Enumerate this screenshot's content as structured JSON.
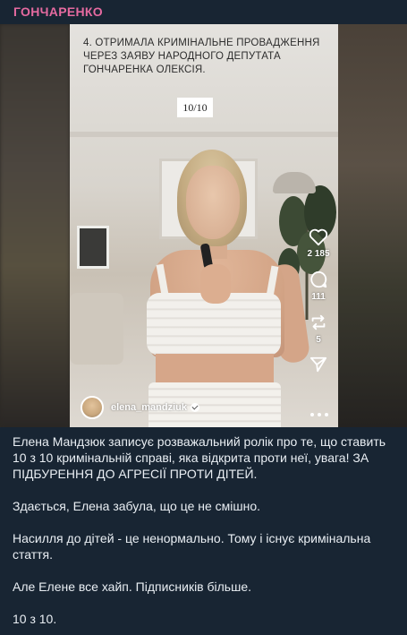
{
  "channel": {
    "name": "ГОНЧАРЕНКО"
  },
  "video": {
    "caption": "4. ОТРИМАЛА КРИМІНАЛЬНЕ ПРОВАДЖЕННЯ ЧЕРЕЗ ЗАЯВУ НАРОДНОГО ДЕПУТАТА ГОНЧАРЕНКА ОЛЕКСІЯ.",
    "counter": "10/10",
    "likes": "2 185",
    "comments": "111",
    "reposts": "5",
    "username": "elena_mandziuk",
    "icons": [
      "heart-icon",
      "comment-icon",
      "repost-icon",
      "send-icon",
      "more-icon",
      "verified-icon"
    ]
  },
  "post": {
    "paragraphs": [
      "Елена Мандзюк записує розважальний ролік про те, що ставить 10 з 10 кримінальній справі, яка відкрита проти неї, увага! ЗА ПІДБУРЕННЯ ДО АГРЕСІЇ ПРОТИ ДІТЕЙ.",
      "Здається, Елена забула, що це не смішно.",
      "Насилля до дітей - це ненормально. Тому і існує кримінальна стаття.",
      "Але Елене все хайп. Підписників більше.",
      "10 з 10."
    ]
  },
  "colors": {
    "channel_accent": "#e56aa0",
    "background": "#182533",
    "text": "#e9eef3"
  }
}
